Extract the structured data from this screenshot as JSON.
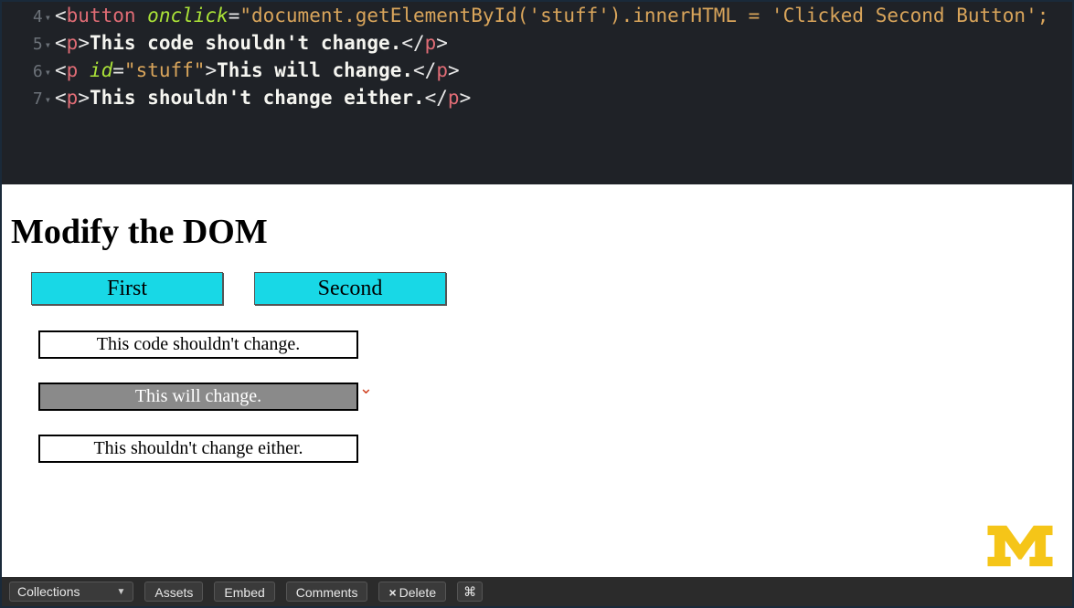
{
  "editor": {
    "lines": [
      {
        "num": "4",
        "html": "<span class='tok-punc'>&lt;</span><span class='tok-tag'>button</span> <span class='tok-attr'>onclick</span><span class='tok-punc'>=</span><span class='tok-str'>\"document.getElementById('stuff').innerHTML = 'Clicked Second Button';</span>"
      },
      {
        "num": "5",
        "html": "<span class='tok-punc'>&lt;</span><span class='tok-tag'>p</span><span class='tok-punc'>&gt;</span><span class='tok-text'>This code shouldn't change.</span><span class='tok-punc'>&lt;/</span><span class='tok-tag'>p</span><span class='tok-punc'>&gt;</span>"
      },
      {
        "num": "6",
        "html": "<span class='tok-punc'>&lt;</span><span class='tok-tag'>p</span> <span class='tok-attr'>id</span><span class='tok-punc'>=</span><span class='tok-str'>\"stuff\"</span><span class='tok-punc'>&gt;</span><span class='tok-text'>This will change.</span><span class='tok-punc'>&lt;/</span><span class='tok-tag'>p</span><span class='tok-punc'>&gt;</span>"
      },
      {
        "num": "7",
        "html": "<span class='tok-punc'>&lt;</span><span class='tok-tag'>p</span><span class='tok-punc'>&gt;</span><span class='tok-text'>This shouldn't change either.</span><span class='tok-punc'>&lt;/</span><span class='tok-tag'>p</span><span class='tok-punc'>&gt;</span>"
      }
    ]
  },
  "preview": {
    "heading": "Modify the DOM",
    "buttons": {
      "first": "First",
      "second": "Second"
    },
    "paras": {
      "p1": "This code shouldn't change.",
      "p2": "This will change.",
      "p3": "This shouldn't change either."
    }
  },
  "toolbar": {
    "collections": "Collections",
    "assets": "Assets",
    "embed": "Embed",
    "comments": "Comments",
    "delete": "Delete",
    "cmd": "⌘"
  },
  "logo": {
    "alt": "M"
  }
}
